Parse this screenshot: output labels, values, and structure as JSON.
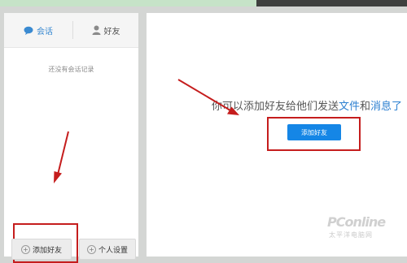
{
  "tabs": {
    "chat": "会话",
    "friends": "好友"
  },
  "empty_text": "还没有会话记录",
  "left_buttons": {
    "add_friend": "添加好友",
    "personal_settings": "个人设置"
  },
  "right": {
    "hint_prefix": "你可以添加好友给他们发送",
    "hint_files": "文件",
    "hint_and": "和",
    "hint_messages": "消息了",
    "add_friend_button": "添加好友"
  },
  "watermark": {
    "logo": "PConline",
    "sub": "太平洋电脑网"
  },
  "colors": {
    "accent": "#1586e6",
    "annotation": "#c51d1d"
  },
  "icons": [
    "chat-bubble-icon",
    "user-icon",
    "plus-circle-icon"
  ]
}
